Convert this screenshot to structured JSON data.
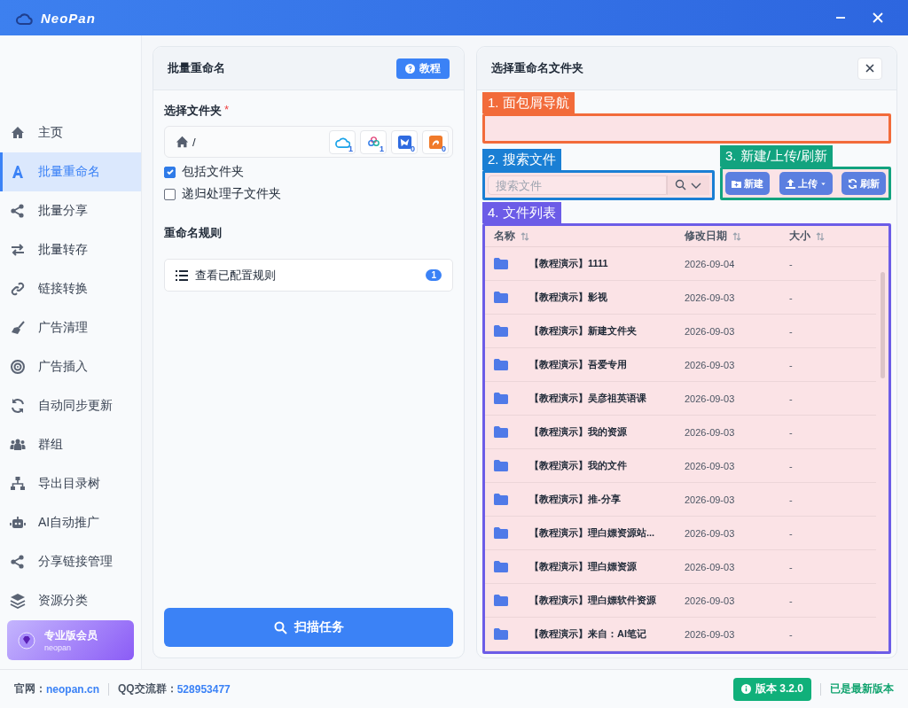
{
  "window": {
    "title": "NeoPan"
  },
  "sidebar": {
    "items": [
      {
        "label": "主页",
        "selected": false
      },
      {
        "label": "批量重命名",
        "selected": true
      },
      {
        "label": "批量分享",
        "selected": false
      },
      {
        "label": "批量转存",
        "selected": false
      },
      {
        "label": "链接转换",
        "selected": false
      },
      {
        "label": "广告清理",
        "selected": false
      },
      {
        "label": "广告插入",
        "selected": false
      },
      {
        "label": "自动同步更新",
        "selected": false
      },
      {
        "label": "群组",
        "selected": false
      },
      {
        "label": "导出目录树",
        "selected": false
      },
      {
        "label": "AI自动推广",
        "selected": false
      },
      {
        "label": "分享链接管理",
        "selected": false
      },
      {
        "label": "资源分类",
        "selected": false
      }
    ],
    "member": {
      "title": "专业版会员",
      "subtitle": "neopan"
    }
  },
  "left_panel": {
    "title": "批量重命名",
    "help_button": "教程",
    "folder_label": "选择文件夹",
    "required_mark": "*",
    "path": "/",
    "drives": [
      {
        "count": "1"
      },
      {
        "count": "1"
      },
      {
        "count": "0"
      },
      {
        "count": "0"
      }
    ],
    "options": [
      {
        "label": "包括文件夹",
        "checked": true
      },
      {
        "label": "递归处理子文件夹",
        "checked": false
      }
    ],
    "rules_title": "重命名规则",
    "rules_button": "查看已配置规则",
    "rules_count": "1",
    "scan_button": "扫描任务"
  },
  "right_panel": {
    "title": "选择重命名文件夹",
    "search_placeholder": "搜索文件",
    "buttons": [
      {
        "label": "新建"
      },
      {
        "label": "上传"
      },
      {
        "label": "刷新"
      }
    ],
    "columns": [
      "名称",
      "修改日期",
      "大小"
    ],
    "rows": [
      {
        "name": "【教程演示】1111",
        "date": "2026-09-04",
        "size": "-"
      },
      {
        "name": "【教程演示】影视",
        "date": "2026-09-03",
        "size": "-"
      },
      {
        "name": "【教程演示】新建文件夹",
        "date": "2026-09-03",
        "size": "-"
      },
      {
        "name": "【教程演示】吾爱专用",
        "date": "2026-09-03",
        "size": "-"
      },
      {
        "name": "【教程演示】吴彦祖英语课",
        "date": "2026-09-03",
        "size": "-"
      },
      {
        "name": "【教程演示】我的资源",
        "date": "2026-09-03",
        "size": "-"
      },
      {
        "name": "【教程演示】我的文件",
        "date": "2026-09-03",
        "size": "-"
      },
      {
        "name": "【教程演示】推-分享",
        "date": "2026-09-03",
        "size": "-"
      },
      {
        "name": "【教程演示】理白嫖资源站...",
        "date": "2026-09-03",
        "size": "-"
      },
      {
        "name": "【教程演示】理白嫖资源",
        "date": "2026-09-03",
        "size": "-"
      },
      {
        "name": "【教程演示】理白嫖软件资源",
        "date": "2026-09-03",
        "size": "-"
      },
      {
        "name": "【教程演示】来自：AI笔记",
        "date": "2026-09-03",
        "size": "-"
      }
    ]
  },
  "annotations": [
    {
      "label": "1. 面包屑导航",
      "color": "#f26b3a"
    },
    {
      "label": "2. 搜索文件",
      "color": "#1a7fd4"
    },
    {
      "label": "3. 新建/上传/刷新",
      "color": "#12a37f"
    },
    {
      "label": "4. 文件列表",
      "color": "#6c5ce7"
    }
  ],
  "status_bar": {
    "site_label": "官网：",
    "site": "neopan.cn",
    "group_label": "QQ交流群：",
    "group": "528953477",
    "version": "版本 3.2.0",
    "update": "已是最新版本"
  }
}
